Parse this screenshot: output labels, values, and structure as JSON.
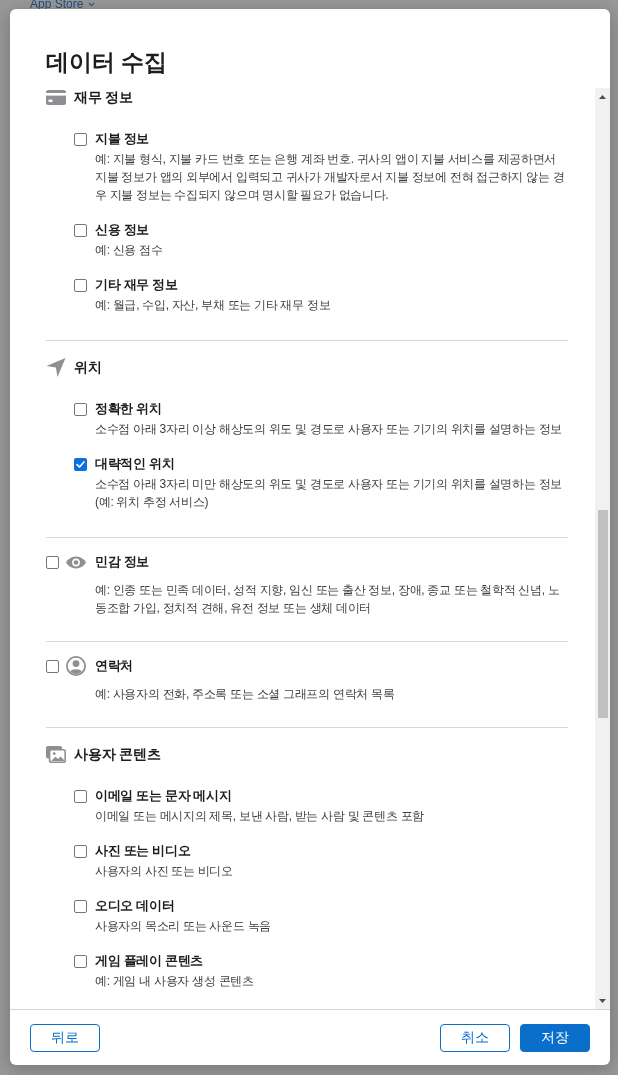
{
  "background": {
    "app_menu": "App Store"
  },
  "dialog": {
    "title": "데이터 수집",
    "sections": [
      {
        "kind": "group",
        "title": "재무 정보",
        "items": [
          {
            "label": "지불 정보",
            "description": "예: 지불 형식, 지불 카드 번호 또는 은행 계좌 번호. 귀사의 앱이 지불 서비스를 제공하면서 지불 정보가 앱의 외부에서 입력되고 귀사가 개발자로서 지불 정보에 전혀 접근하지 않는 경우 지불 정보는 수집되지 않으며 명시할 필요가 없습니다.",
            "checked": false
          },
          {
            "label": "신용 정보",
            "description": "예: 신용 점수",
            "checked": false
          },
          {
            "label": "기타 재무 정보",
            "description": "예: 월급, 수입, 자산, 부채 또는 기타 재무 정보",
            "checked": false
          }
        ]
      },
      {
        "kind": "group",
        "title": "위치",
        "items": [
          {
            "label": "정확한 위치",
            "description": "소수점 아래 3자리 이상 해상도의 위도 및 경도로 사용자 또는 기기의 위치를 설명하는 정보",
            "checked": false
          },
          {
            "label": "대략적인 위치",
            "description": "소수점 아래 3자리 미만 해상도의 위도 및 경도로 사용자 또는 기기의 위치를 설명하는 정보(예: 위치 추정 서비스)",
            "checked": true
          }
        ]
      },
      {
        "kind": "single",
        "label": "민감 정보",
        "description": "예: 인종 또는 민족 데이터, 성적 지향, 임신 또는 출산 정보, 장애, 종교 또는 철학적 신념, 노동조합 가입, 정치적 견해, 유전 정보 또는 생체 데이터",
        "checked": false
      },
      {
        "kind": "single",
        "label": "연락처",
        "description": "예: 사용자의 전화, 주소록 또는 소셜 그래프의 연락처 목록",
        "checked": false
      },
      {
        "kind": "group",
        "title": "사용자 콘텐츠",
        "items": [
          {
            "label": "이메일 또는 문자 메시지",
            "description": "이메일 또는 메시지의 제목, 보낸 사람, 받는 사람 및 콘텐츠 포함",
            "checked": false
          },
          {
            "label": "사진 또는 비디오",
            "description": "사용자의 사진 또는 비디오",
            "checked": false
          },
          {
            "label": "오디오 데이터",
            "description": "사용자의 목소리 또는 사운드 녹음",
            "checked": false
          },
          {
            "label": "게임 플레이 콘텐츠",
            "description": "예: 게임 내 사용자 생성 콘텐츠",
            "checked": false
          }
        ]
      }
    ],
    "footer": {
      "left_buttons": [
        {
          "label": "뒤로",
          "kind": "outline"
        }
      ],
      "right_buttons": [
        {
          "label": "취소",
          "kind": "outline"
        },
        {
          "label": "저장",
          "kind": "primary"
        }
      ]
    }
  }
}
